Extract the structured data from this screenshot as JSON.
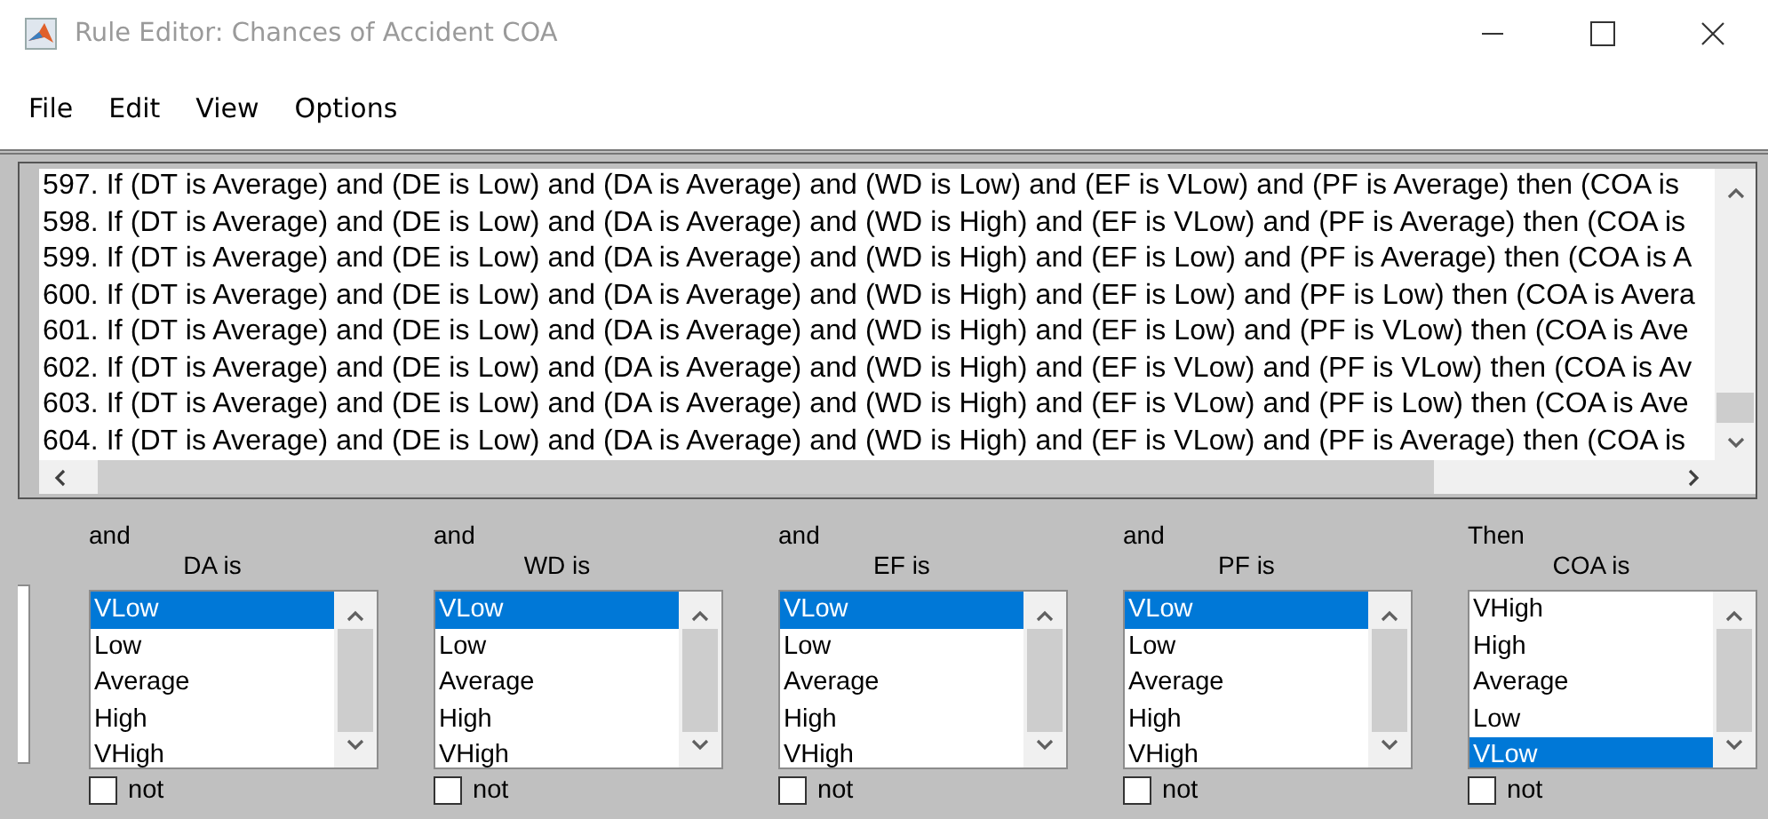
{
  "window": {
    "title": "Rule Editor: Chances of Accident COA"
  },
  "menu": [
    "File",
    "Edit",
    "View",
    "Options"
  ],
  "rules": [
    "597. If (DT is Average) and (DE is Low) and (DA is Average) and (WD is Low) and (EF is VLow) and (PF is Average) then (COA is",
    "598. If (DT is Average) and (DE is Low) and (DA is Average) and (WD is High) and (EF is VLow) and (PF is Average) then (COA is",
    "599. If (DT is Average) and (DE is Low) and (DA is Average) and (WD is High) and (EF is Low) and (PF is Average) then (COA is A",
    "600. If (DT is Average) and (DE is Low) and (DA is Average) and (WD is High) and (EF is Low) and (PF is Low) then (COA is Avera",
    "601. If (DT is Average) and (DE is Low) and (DA is Average) and (WD is High) and (EF is Low) and (PF is VLow) then (COA is Ave",
    "602. If (DT is Average) and (DE is Low) and (DA is Average) and (WD is High) and (EF is VLow) and (PF is VLow) then (COA is Av",
    "603. If (DT is Average) and (DE is Low) and (DA is Average) and (WD is High) and (EF is VLow) and (PF is Low) then (COA is Ave",
    "604. If (DT is Average) and (DE is Low) and (DA is Average) and (WD is High) and (EF is VLow) and (PF is Average) then (COA is"
  ],
  "clauses": [
    {
      "connector": "and",
      "label": "DA is",
      "options": [
        {
          "label": "VLow",
          "selected": true
        },
        {
          "label": "Low",
          "selected": false
        },
        {
          "label": "Average",
          "selected": false
        },
        {
          "label": "High",
          "selected": false
        },
        {
          "label": "VHigh",
          "selected": false
        }
      ],
      "not": false,
      "not_label": "not"
    },
    {
      "connector": "and",
      "label": "WD is",
      "options": [
        {
          "label": "VLow",
          "selected": true
        },
        {
          "label": "Low",
          "selected": false
        },
        {
          "label": "Average",
          "selected": false
        },
        {
          "label": "High",
          "selected": false
        },
        {
          "label": "VHigh",
          "selected": false
        }
      ],
      "not": false,
      "not_label": "not"
    },
    {
      "connector": "and",
      "label": "EF is",
      "options": [
        {
          "label": "VLow",
          "selected": true
        },
        {
          "label": "Low",
          "selected": false
        },
        {
          "label": "Average",
          "selected": false
        },
        {
          "label": "High",
          "selected": false
        },
        {
          "label": "VHigh",
          "selected": false
        }
      ],
      "not": false,
      "not_label": "not"
    },
    {
      "connector": "and",
      "label": "PF is",
      "options": [
        {
          "label": "VLow",
          "selected": true
        },
        {
          "label": "Low",
          "selected": false
        },
        {
          "label": "Average",
          "selected": false
        },
        {
          "label": "High",
          "selected": false
        },
        {
          "label": "VHigh",
          "selected": false
        }
      ],
      "not": false,
      "not_label": "not"
    },
    {
      "connector": "Then",
      "label": "COA is",
      "options": [
        {
          "label": "VHigh",
          "selected": false
        },
        {
          "label": "High",
          "selected": false
        },
        {
          "label": "Average",
          "selected": false
        },
        {
          "label": "Low",
          "selected": false
        },
        {
          "label": "VLow",
          "selected": true
        }
      ],
      "not": false,
      "not_label": "not"
    }
  ]
}
